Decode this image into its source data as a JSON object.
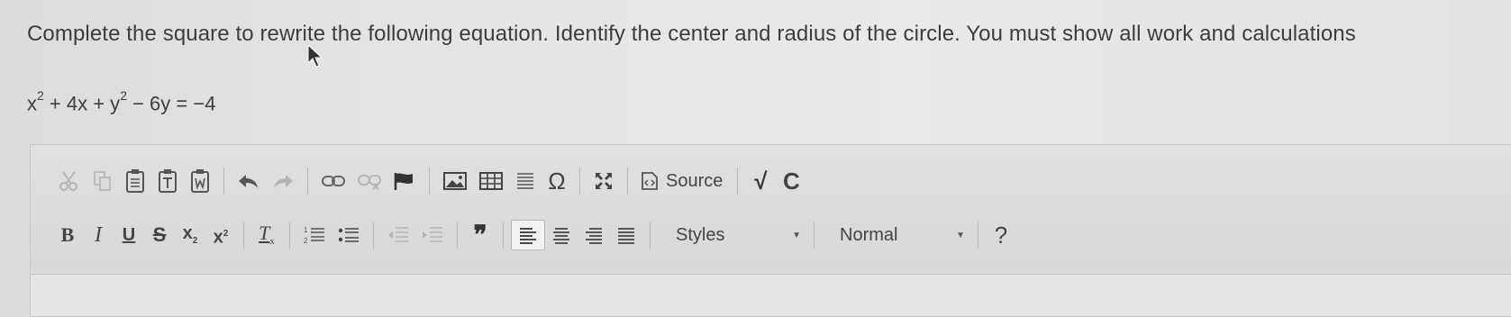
{
  "question": {
    "text": "Complete the square to rewrite the following equation. Identify the center and radius of the circle. You must show all work and calculations"
  },
  "equation": {
    "part1": "x",
    "exp1": "2",
    "part2": " + 4x + y",
    "exp2": "2",
    "part3": " − 6y = −4"
  },
  "editor": {
    "toolbar": {
      "row1": {
        "source_label": "Source",
        "math_label": "√",
        "chem_label": "C",
        "special_char": "Ω"
      },
      "row2": {
        "bold": "B",
        "italic": "I",
        "underline": "U",
        "strike": "S",
        "subscript": "x",
        "subscript_small": "2",
        "superscript": "x",
        "superscript_small": "2",
        "remove_format": "T",
        "remove_format_small": "x",
        "blockquote": "❞",
        "styles_label": "Styles",
        "format_label": "Normal",
        "help_label": "?"
      }
    }
  },
  "colors": {
    "text": "#3d3d3d",
    "icon": "#444444",
    "disabled": "#a9a9a9",
    "toolbar_bg": "#dcdcda"
  }
}
